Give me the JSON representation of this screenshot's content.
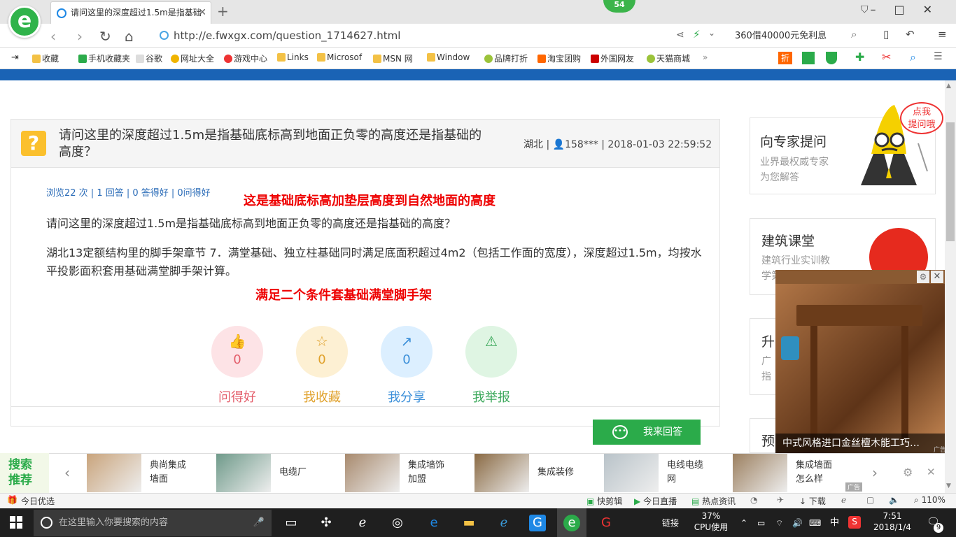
{
  "browser": {
    "tab_title": "请问这里的深度超过1.5m是指基础",
    "badge_count": "54",
    "url": "http://e.fwxgx.com/question_1714627.html",
    "ad_search": "360借40000元免利息"
  },
  "bookmarks": [
    "收藏",
    "手机收藏夹",
    "谷歌",
    "网址大全",
    "游戏中心",
    "Links",
    "Microsof",
    "MSN 网",
    "Window",
    "品牌打折",
    "淘宝团购",
    "外国网友",
    "天猫商城"
  ],
  "question": {
    "title": "请问这里的深度超过1.5m是指基础底标高到地面正负零的高度还是指基础的高度？",
    "location": "湖北",
    "user": "158***",
    "datetime": "2018-01-03 22:59:52",
    "stats": "浏览22 次 | 1 回答 | 0 答得好 | 0问得好",
    "annotation_1": "这是基础底标高加垫层高度到自然地面的高度",
    "body_1": "请问这里的深度超过1.5m是指基础底标高到地面正负零的高度还是指基础的高度？",
    "body_2": "湖北13定额结构里的脚手架章节   7．满堂基础、独立柱基础同时满足底面积超过4m2（包括工作面的宽度），深度超过1.5m，均按水平投影面积套用基础满堂脚手架计算。",
    "annotation_2": "满足二个条件套基础满堂脚手架",
    "actions": [
      {
        "label": "问得好",
        "count": "0",
        "color": "#e35d6a",
        "bg": "#fde3e6",
        "icon": "thumbs-up-icon",
        "glyph": "👍"
      },
      {
        "label": "我收藏",
        "count": "0",
        "color": "#e0a12b",
        "bg": "#fdf0d3",
        "icon": "star-icon",
        "glyph": "☆"
      },
      {
        "label": "我分享",
        "count": "0",
        "color": "#3b8fd9",
        "bg": "#dcefff",
        "icon": "share-icon",
        "glyph": "↗"
      },
      {
        "label": "我举报",
        "count": "",
        "color": "#3ba85a",
        "bg": "#dff5e3",
        "icon": "warning-icon",
        "glyph": "⚠"
      }
    ],
    "answer_button": "我来回答"
  },
  "sidebar": {
    "expert_title": "向专家提问",
    "expert_sub": "业界最权威专家\n为您解答",
    "bubble": "点我\n提问哦",
    "class_title": "建筑课堂",
    "class_sub": "建筑行业实训教\n学第一平台",
    "card3_title": "升",
    "card3_sub1": "广",
    "card3_sub2": "指",
    "card4_title": "预"
  },
  "ad": {
    "caption": "中式风格进口金丝檀木能工巧…",
    "tag": "广告"
  },
  "search_recommend": {
    "label": "搜索推荐",
    "items": [
      {
        "text": "典尚集成\n墙面",
        "color": "#c9a47c"
      },
      {
        "text": "电缆厂",
        "color": "#6f9a8a"
      },
      {
        "text": "集成墙饰\n加盟",
        "color": "#a88a6e"
      },
      {
        "text": "集成装修",
        "color": "#8a6a44"
      },
      {
        "text": "电线电缆\n网",
        "color": "#b9c3c9"
      },
      {
        "text": "集成墙面\n怎么样",
        "color": "#9c8060"
      }
    ],
    "ad_tag": "广告"
  },
  "statusbar": {
    "left": "今日优选",
    "items": [
      "快剪辑",
      "今日直播",
      "热点资讯",
      "下载"
    ],
    "zoom": "110%"
  },
  "taskbar": {
    "search_placeholder": "在这里输入你要搜索的内容",
    "link_label": "链接",
    "cpu_pct": "37%",
    "cpu_label": "CPU使用",
    "ime": "中",
    "time": "7:51",
    "date": "2018/1/4",
    "notif_count": "9"
  }
}
